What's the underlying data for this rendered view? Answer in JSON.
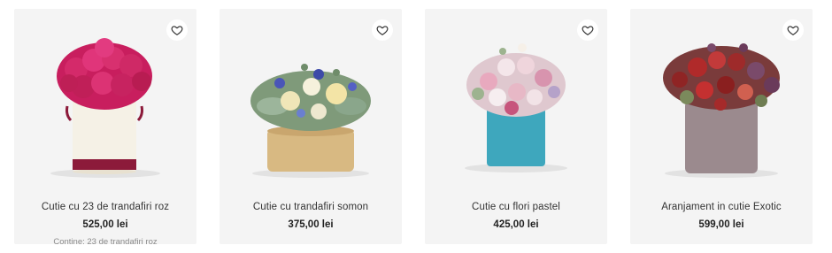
{
  "products": [
    {
      "name": "Cutie cu 23 de trandafiri roz",
      "price": "525,00 lei",
      "contains": "Contine: 23 de trandafiri roz",
      "icon": "heart-icon",
      "image": "pink-roses-white-hatbox"
    },
    {
      "name": "Cutie cu trandafiri somon",
      "price": "375,00 lei",
      "icon": "heart-icon",
      "image": "mixed-flowers-beige-box"
    },
    {
      "name": "Cutie cu flori pastel",
      "price": "425,00 lei",
      "icon": "heart-icon",
      "image": "pastel-flowers-teal-box"
    },
    {
      "name": "Aranjament in cutie Exotic",
      "price": "599,00 lei",
      "icon": "heart-icon",
      "image": "red-flowers-grey-box"
    }
  ],
  "colors": {
    "card_bg": "#f4f4f4",
    "heart_stroke": "#333333",
    "text_muted": "#8a8a8a"
  }
}
